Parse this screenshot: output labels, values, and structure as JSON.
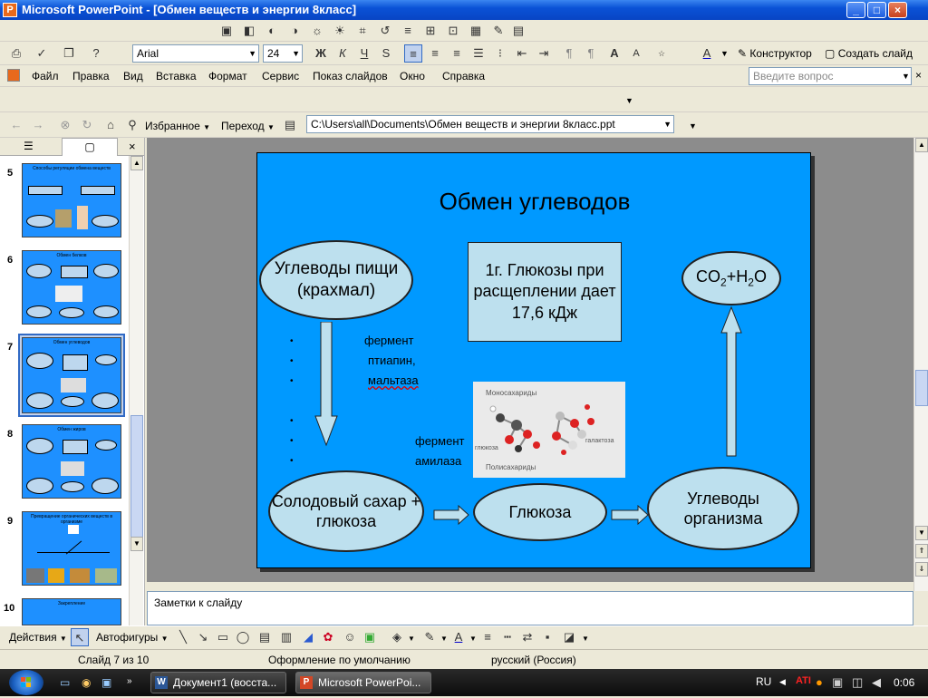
{
  "window": {
    "title": "Microsoft PowerPoint - [Обмен веществ и энергии 8класс]",
    "min": "_",
    "max": "□",
    "close": "×"
  },
  "formatting": {
    "font": "Arial",
    "size": "24",
    "bold": "Ж",
    "italic": "К",
    "underline": "Ч",
    "shadow": "S",
    "designer": "Конструктор",
    "new_slide": "Создать слайд"
  },
  "menu": {
    "items": [
      "Файл",
      "Правка",
      "Вид",
      "Вставка",
      "Формат",
      "Сервис",
      "Показ слайдов",
      "Окно",
      "Справка"
    ],
    "help_placeholder": "Введите вопрос"
  },
  "web": {
    "favorites": "Избранное",
    "go": "Переход",
    "path": "C:\\Users\\all\\Documents\\Обмен веществ и энергии 8класс.ppt"
  },
  "thumbs": [
    {
      "num": "5",
      "title": "Способы регуляции обмена веществ"
    },
    {
      "num": "6",
      "title": "Обмен белков"
    },
    {
      "num": "7",
      "title": "Обмен углеводов"
    },
    {
      "num": "8",
      "title": "Обмен жиров"
    },
    {
      "num": "9",
      "title": "Превращение органических веществ в организме"
    },
    {
      "num": "10",
      "title": "Закрепление"
    }
  ],
  "slide": {
    "title": "Обмен углеводов",
    "food_carbs": "Углеводы пищи (крахмал)",
    "glucose_fact": "1г. Глюкозы при расщеплении дает 17,6 кДж",
    "products": "CO2+H2O",
    "malt_sugar": "Солодовый сахар + глюкоза",
    "glucose": "Глюкоза",
    "body_carbs": "Углеводы организма",
    "enzyme1_line1": "фермент",
    "enzyme1_line2": "птиапин,",
    "enzyme1_line3": "мальтаза",
    "enzyme2_line1": "фермент",
    "enzyme2_line2": "амилаза",
    "image_label_mono": "Моносахариды",
    "image_label_poly": "Полисахариды",
    "image_label_glucose": "глюкоза",
    "image_label_galactose": "галактоза"
  },
  "notes_placeholder": "Заметки к слайду",
  "drawbar": {
    "actions": "Действия",
    "autoshapes": "Автофигуры"
  },
  "status": {
    "slide": "Слайд 7 из 10",
    "design": "Оформление по умолчанию",
    "lang": "русский (Россия)"
  },
  "taskbar": {
    "task1": "Документ1 (восста...",
    "task2": "Microsoft PowerPoi...",
    "lang": "RU",
    "time": "0:06"
  },
  "colors": {
    "slide_bg": "#0099ff",
    "shape_fill": "#bde0ee",
    "titlebar": "#0a52d6"
  }
}
